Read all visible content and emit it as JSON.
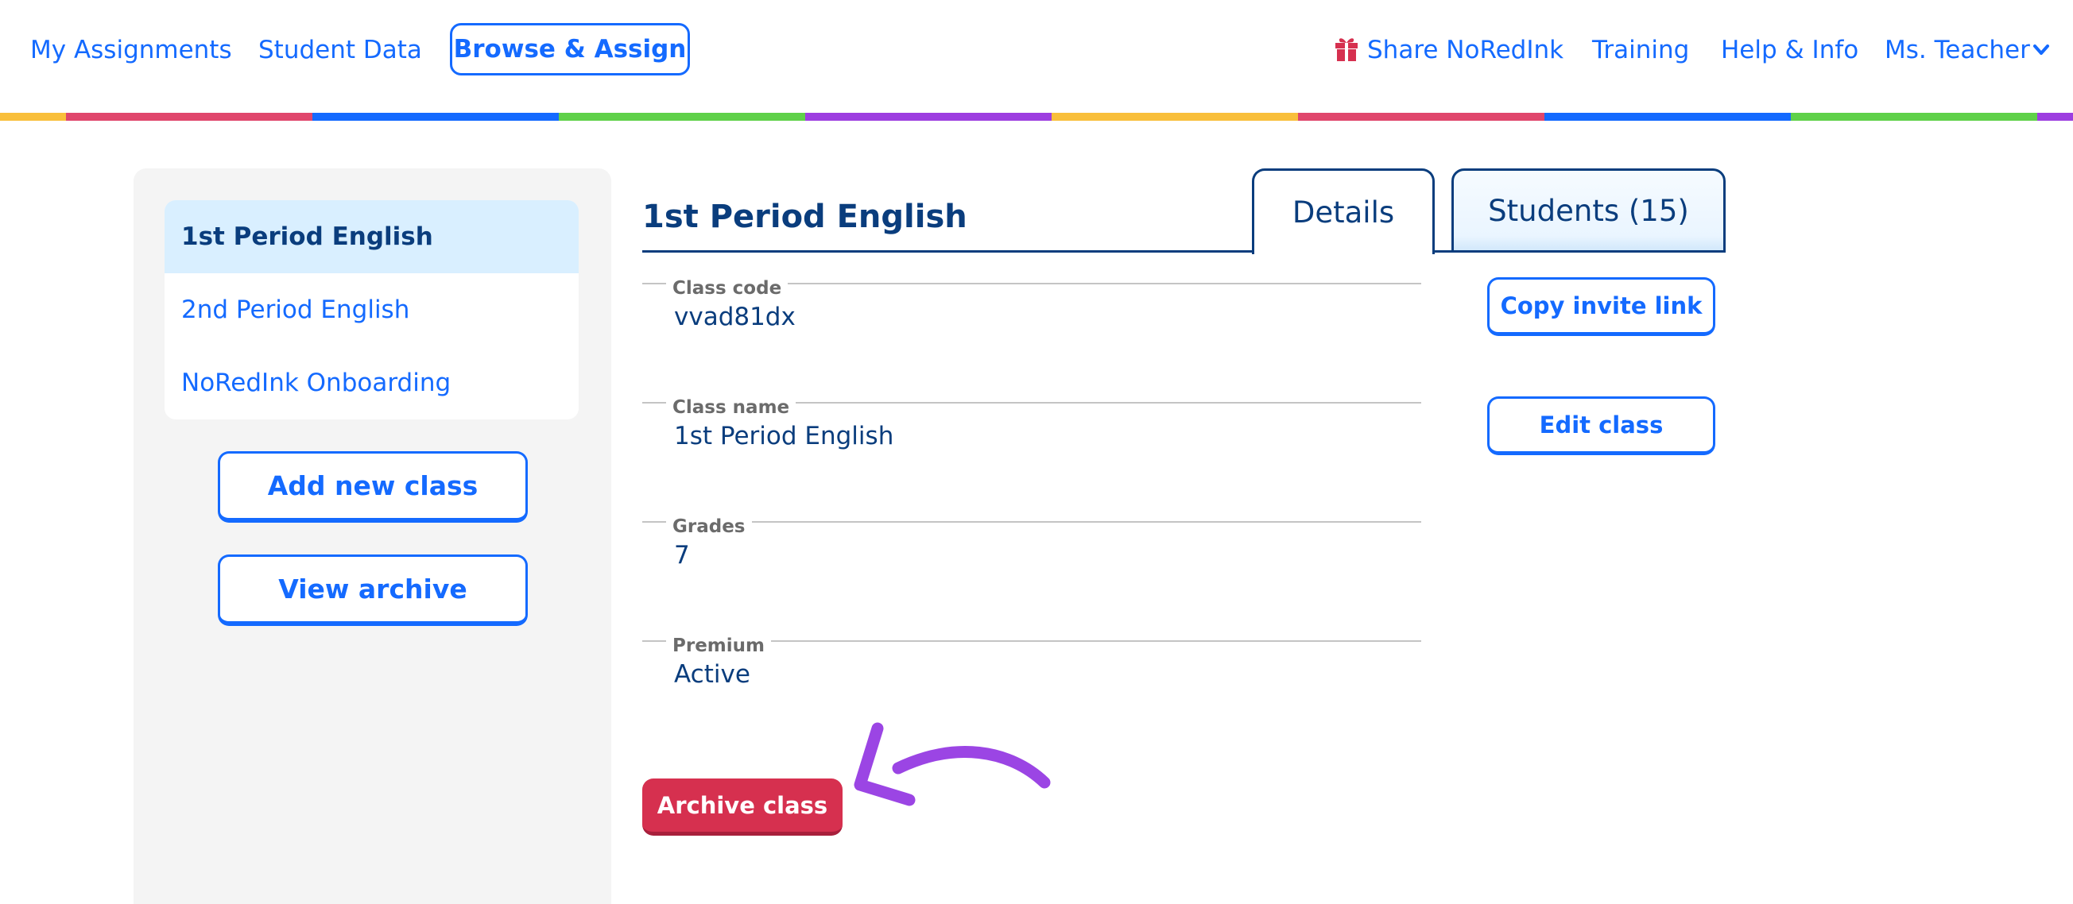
{
  "topnav": {
    "links": [
      {
        "label": "My Assignments"
      },
      {
        "label": "Student Data"
      }
    ],
    "active_link": "Browse & Assign",
    "share": "Share NoRedInk",
    "training": "Training",
    "help": "Help & Info",
    "user_menu": "Ms. Teacher",
    "icons": {
      "share": "gift-icon",
      "user_menu": "chevron-down-icon"
    },
    "rainbow_colors": [
      "#f9bf3b",
      "#e0466c",
      "#146aff",
      "#5fd149",
      "#9d3ee0",
      "#f9bf3b",
      "#e0466c",
      "#146aff",
      "#5fd149",
      "#9d3ee0"
    ]
  },
  "sidebar": {
    "classes": [
      {
        "label": "1st Period English",
        "selected": true
      },
      {
        "label": "2nd Period English",
        "selected": false
      },
      {
        "label": "NoRedInk Onboarding",
        "selected": false
      }
    ],
    "add_button": "Add new class",
    "archive_button": "View archive"
  },
  "main": {
    "title": "1st Period English",
    "tabs": [
      {
        "label": "Details",
        "active": true
      },
      {
        "label": "Students (15)",
        "active": false
      }
    ],
    "fields": [
      {
        "label": "Class code",
        "value": "vvad81dx"
      },
      {
        "label": "Class name",
        "value": "1st Period English"
      },
      {
        "label": "Grades",
        "value": "7"
      },
      {
        "label": "Premium",
        "value": "Active"
      }
    ],
    "copy_invite_button": "Copy invite link",
    "edit_class_button": "Edit class",
    "archive_class_button": "Archive class",
    "annotation": "curved-arrow-icon"
  },
  "colors": {
    "link_blue": "#146aff",
    "navy": "#0a3d7d",
    "danger": "#d6304f",
    "selected_bg": "#d9efff",
    "annotation_purple": "#9b45e4"
  }
}
